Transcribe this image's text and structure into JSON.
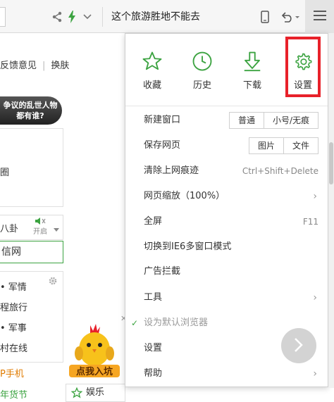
{
  "toolbar": {
    "search_text": "这个旅游胜地不能去",
    "icons": [
      "share-icon",
      "lightning-icon",
      "chevron-down-icon",
      "mobile-icon",
      "undo-icon",
      "menu-icon"
    ]
  },
  "background_page": {
    "nav_items": [
      "反馈意见",
      "换肤"
    ],
    "headline": "争议的乱世人物都有谁?",
    "card_text": "圈",
    "gossip_text": "八卦",
    "mute_label": "开启",
    "xinxi_text": "信网",
    "list_items": [
      "• 军情",
      "程旅行",
      "• 军事",
      "村在线"
    ],
    "orange_text": "P手机",
    "green_text": "年货节",
    "chick_caption": "点我入坑",
    "yule_label": "娱乐"
  },
  "menu": {
    "top_icons": [
      {
        "label": "收藏",
        "icon": "star-icon"
      },
      {
        "label": "历史",
        "icon": "clock-icon"
      },
      {
        "label": "下载",
        "icon": "download-icon"
      },
      {
        "label": "设置",
        "icon": "gear-icon"
      }
    ],
    "new_window": {
      "label": "新建窗口",
      "options": [
        "普通",
        "小号/无痕"
      ]
    },
    "save_page": {
      "label": "保存网页",
      "options": [
        "图片",
        "文件"
      ]
    },
    "clear_traces": {
      "label": "清除上网痕迹",
      "shortcut": "Ctrl+Shift+Delete"
    },
    "zoom": {
      "label": "网页缩放（100%）"
    },
    "fullscreen": {
      "label": "全屏",
      "shortcut": "F11"
    },
    "ie6_mode": {
      "label": "切换到IE6多窗口模式"
    },
    "ad_block": {
      "label": "广告拦截"
    },
    "tools": {
      "label": "工具"
    },
    "default_browser": {
      "label": "设为默认浏览器"
    },
    "settings": {
      "label": "设置"
    },
    "help": {
      "label": "帮助"
    }
  },
  "colors": {
    "accent": "#3ca341",
    "highlight": "#e8212a"
  }
}
